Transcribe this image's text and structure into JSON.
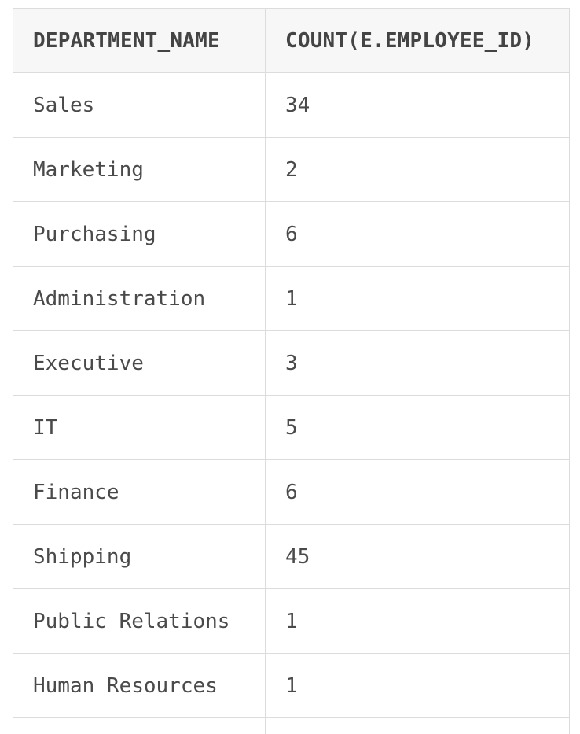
{
  "table": {
    "columns": [
      "DEPARTMENT_NAME",
      "COUNT(E.EMPLOYEE_ID)"
    ],
    "rows": [
      [
        "Sales",
        "34"
      ],
      [
        "Marketing",
        "2"
      ],
      [
        "Purchasing",
        "6"
      ],
      [
        "Administration",
        "1"
      ],
      [
        "Executive",
        "3"
      ],
      [
        "IT",
        "5"
      ],
      [
        "Finance",
        "6"
      ],
      [
        "Shipping",
        "45"
      ],
      [
        "Public Relations",
        "1"
      ],
      [
        "Human Resources",
        "1"
      ]
    ]
  }
}
